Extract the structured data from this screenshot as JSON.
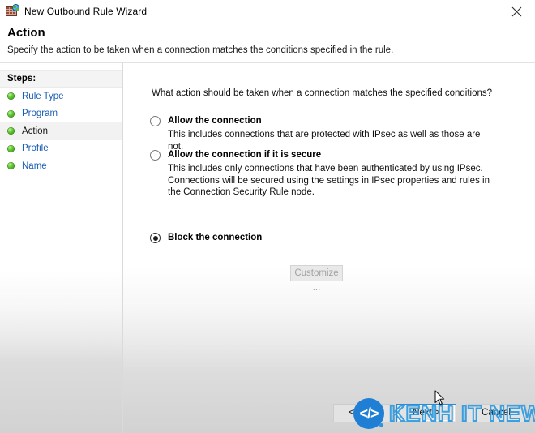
{
  "window": {
    "title": "New Outbound Rule Wizard",
    "icon": "firewall-globe-icon",
    "close_label": "✕"
  },
  "header": {
    "title": "Action",
    "subtitle": "Specify the action to be taken when a connection matches the conditions specified in the rule."
  },
  "sidebar": {
    "heading": "Steps:",
    "items": [
      {
        "label": "Rule Type",
        "state": "completed"
      },
      {
        "label": "Program",
        "state": "completed"
      },
      {
        "label": "Action",
        "state": "current"
      },
      {
        "label": "Profile",
        "state": "completed"
      },
      {
        "label": "Name",
        "state": "completed"
      }
    ]
  },
  "main": {
    "question": "What action should be taken when a connection matches the specified conditions?",
    "options": [
      {
        "title": "Allow the connection",
        "description": "This includes connections that are protected with IPsec as well as those are not.",
        "selected": false
      },
      {
        "title": "Allow the connection if it is secure",
        "description": "This includes only connections that have been authenticated by using IPsec.  Connections will be secured using the settings in IPsec properties and rules in the Connection Security Rule node.",
        "selected": false
      },
      {
        "title": "Block the connection",
        "description": "",
        "selected": true
      }
    ],
    "customize_button": {
      "label": "Customize ...",
      "enabled": false
    }
  },
  "footer": {
    "back_label": "< Back",
    "next_label": "Next >",
    "cancel_label": "Cancel"
  },
  "watermark": {
    "logo_glyph": "</>",
    "text": "KENH IT NEWS",
    "color": "#2e9be0"
  },
  "colors": {
    "step_link": "#1a5fb4",
    "step_bullet": "#5ec32f",
    "focus_border": "#2c8ad6",
    "disabled_text": "#a3a3a3"
  }
}
